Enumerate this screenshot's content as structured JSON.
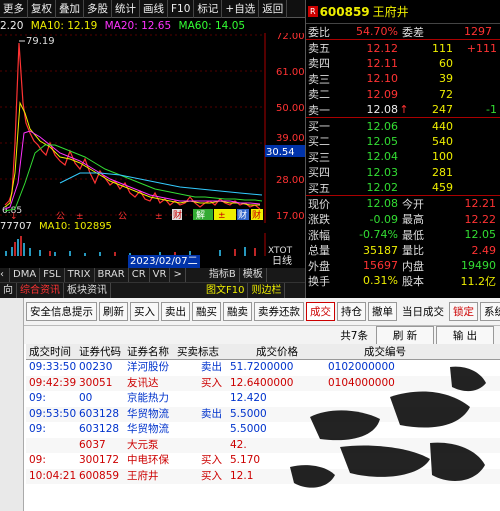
{
  "menu": [
    "更多",
    "复权",
    "叠加",
    "多股",
    "统计",
    "画线",
    "F10",
    "标记",
    "+自选",
    "返回"
  ],
  "ma": {
    "prefix": "2.20",
    "ma10": "MA10: 12.19",
    "ma20": "MA20: 12.65",
    "ma60": "MA60: 14.05"
  },
  "chart": {
    "price_labels": [
      "72.00",
      "61.00",
      "50.00",
      "39.00",
      "28.00",
      "17.00"
    ],
    "peak_label": "79.19",
    "current_price": "30.54",
    "low_label": "6.85",
    "markers": [
      "↓",
      "公",
      "±",
      "公",
      "±",
      "财务",
      "财"
    ],
    "badges": [
      "财",
      "解",
      "±",
      "财",
      "财",
      "财"
    ]
  },
  "vol": {
    "left": "77707",
    "ma10": "MA10: 102895",
    "tick_right": "XTOT"
  },
  "axis": {
    "date": "2023/02/07二",
    "right_label": "日线"
  },
  "tabs": [
    "DMA",
    "FSL",
    "TRIX",
    "BRAR",
    "CR",
    "VR",
    ">",
    "指标B",
    "模板"
  ],
  "bottom_tabs": [
    "向",
    "综合资讯",
    "板块资讯",
    "图文F10",
    "则边栏"
  ],
  "quote": {
    "code": "600859",
    "name": "王府井",
    "weibi_label": "委比",
    "weibi": "54.70%",
    "weicha_label": "委差",
    "weicha": "1297",
    "asks": [
      {
        "label": "卖五",
        "price": "12.12",
        "vol": "111",
        "chg": "+111"
      },
      {
        "label": "卖四",
        "price": "12.11",
        "vol": "60",
        "chg": ""
      },
      {
        "label": "卖三",
        "price": "12.10",
        "vol": "39",
        "chg": ""
      },
      {
        "label": "卖二",
        "price": "12.09",
        "vol": "72",
        "chg": ""
      },
      {
        "label": "卖一",
        "price": "12.08",
        "vol": "247",
        "chg": "-1"
      }
    ],
    "bids": [
      {
        "label": "买一",
        "price": "12.06",
        "vol": "440"
      },
      {
        "label": "买二",
        "price": "12.05",
        "vol": "540"
      },
      {
        "label": "买三",
        "price": "12.04",
        "vol": "100"
      },
      {
        "label": "买四",
        "price": "12.03",
        "vol": "281"
      },
      {
        "label": "买五",
        "price": "12.02",
        "vol": "459"
      }
    ],
    "stats": [
      {
        "l1": "现价",
        "v1": "12.08",
        "l2": "今开",
        "v2": "12.21"
      },
      {
        "l1": "涨跌",
        "v1": "-0.09",
        "l2": "最高",
        "v2": "12.22"
      },
      {
        "l1": "涨幅",
        "v1": "-0.74%",
        "l2": "最低",
        "v2": "12.05"
      },
      {
        "l1": "总量",
        "v1": "35187",
        "l2": "量比",
        "v2": "2.49"
      },
      {
        "l1": "外盘",
        "v1": "15697",
        "l2": "内盘",
        "v2": "19490"
      },
      {
        "l1": "换手",
        "v1": "0.31%",
        "l2": "股本",
        "v2": "11.2亿"
      }
    ]
  },
  "panel": {
    "buttons": [
      "安全信息提示",
      "刷新",
      "买入",
      "卖出",
      "融买",
      "融卖",
      "卖券还款",
      "成交",
      "持仓",
      "撤单",
      "当日成交",
      "锁定",
      "系统"
    ],
    "count": "共7条",
    "refresh": "刷 新",
    "export": "输 出",
    "headers": [
      "成交时间",
      "证券代码",
      "证券名称",
      "买卖标志",
      "成交价格",
      "成交编号"
    ],
    "rows": [
      {
        "time": "09:33:50",
        "code": "00230",
        "name": "洋河股份",
        "flag": "卖出",
        "price": "51.7200000",
        "no": "0102000000",
        "color": "blue"
      },
      {
        "time": "09:42:39",
        "code": "30051",
        "name": "友讯达",
        "flag": "买入",
        "price": "12.6400000",
        "no": "0104000000",
        "color": "dred"
      },
      {
        "time": "09:",
        "code": "00",
        "name": "京能热力",
        "flag": "",
        "price": "12.420",
        "no": "",
        "color": "blue"
      },
      {
        "time": "09:53:50",
        "code": "603128",
        "name": "华贸物流",
        "flag": "卖出",
        "price": "5.5000",
        "no": "",
        "color": "blue"
      },
      {
        "time": "09:",
        "code": "603128",
        "name": "华贸物流",
        "flag": "",
        "price": "5.5000",
        "no": "",
        "color": "blue"
      },
      {
        "time": "",
        "code": "6037",
        "name": "大元泵",
        "flag": "",
        "price": "42.",
        "no": "",
        "color": "dred"
      },
      {
        "time": "09:",
        "code": "300172",
        "name": "中电环保",
        "flag": "买入",
        "price": "5.170",
        "no": "",
        "color": "dred"
      },
      {
        "time": "10:04:21",
        "code": "600859",
        "name": "王府井",
        "flag": "买入",
        "price": "12.1",
        "no": "",
        "color": "dred"
      }
    ]
  }
}
